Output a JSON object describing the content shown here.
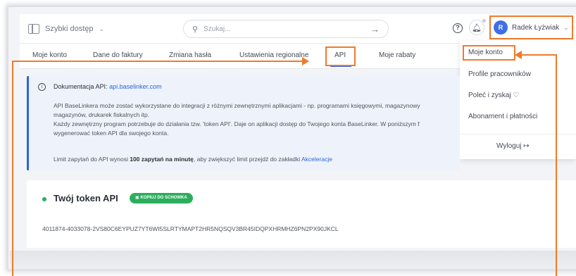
{
  "topbar": {
    "quick_access": "Szybki dostęp",
    "search_placeholder": "Szukaj...",
    "user_initial": "R",
    "user_name": "Radek Łyżwiak"
  },
  "tabs": [
    {
      "label": "Moje konto"
    },
    {
      "label": "Dane do faktury"
    },
    {
      "label": "Zmiana hasła"
    },
    {
      "label": "Ustawienia regionalne"
    },
    {
      "label": "API",
      "active": true
    },
    {
      "label": "Moje rabaty"
    }
  ],
  "dropdown": {
    "items": [
      "Moje konto",
      "Profile pracowników",
      "Poleć i zyskaj ♡",
      "Abonament i płatności"
    ],
    "logout": "Wyloguj ↦"
  },
  "info": {
    "title_prefix": "Dokumentacja API:",
    "title_link": "api.baselinker.com",
    "paragraph_lines": [
      "API BaseLinkera może zostać wykorzystane do integracji z różnymi zewnętrznymi aplikacjami - np. programami księgowymi, magazynowy",
      "magazynów, drukarek fiskalnych itp.",
      "Każdy zewnętrzny program potrzebuje do działania tzw. 'token API'. Daje on aplikacji dostęp do Twojego konta BaseLinker. W poniższym f",
      "wygenerować token API dla swojego konta."
    ],
    "limit_prefix": "Limit zapytań do API wynosi",
    "limit_bold": "100 zapytań na minutę",
    "limit_middle": ", aby zwiększyć limit przejdź do zakładki",
    "limit_link": "Akceleracje"
  },
  "token": {
    "title": "Twój token API",
    "copy_button": "KOPIUJ DO SCHOWKA",
    "value": "4011874-4033078-2VS80C6EYPUZ7YT6WI5SLRTYMAPT2HR5NQSQV3BR45IDQPXHRMHZ6PN2PX90JKCL"
  },
  "colors": {
    "accent_orange": "#f07a2a",
    "primary_blue": "#2d63d8",
    "success_green": "#2cae5c"
  }
}
